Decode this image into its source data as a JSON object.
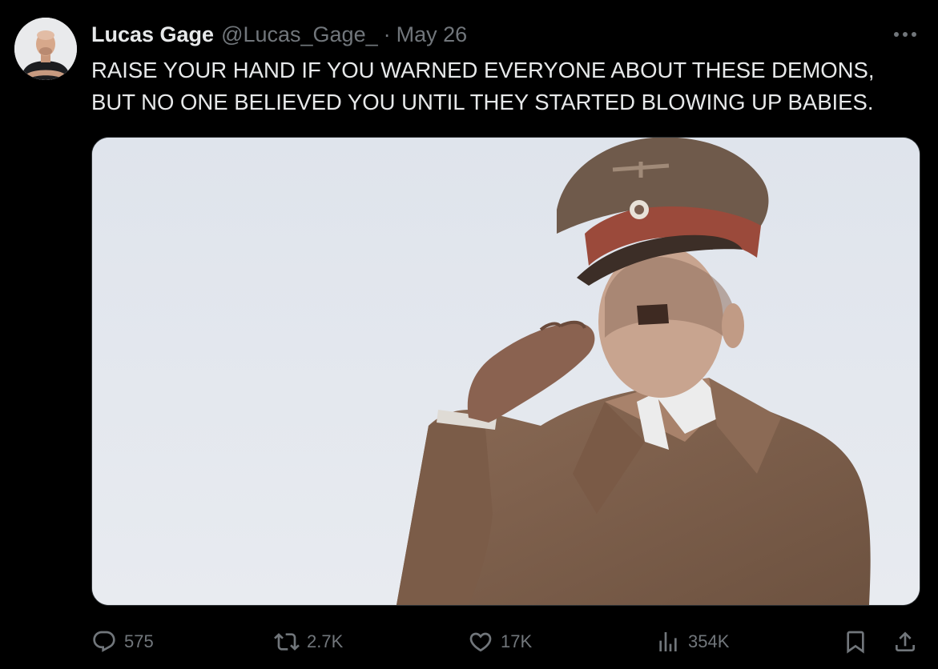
{
  "tweet": {
    "author": {
      "display_name": "Lucas Gage",
      "handle": "@Lucas_Gage_"
    },
    "separator": "·",
    "date": "May 26",
    "text_lines": [
      "RAISE YOUR HAND IF YOU WARNED EVERYONE ABOUT THESE DEMONS,",
      "BUT NO ONE BELIEVED YOU UNTIL THEY STARTED BLOWING UP BABIES."
    ]
  },
  "actions": {
    "reply": {
      "icon": "reply-icon",
      "count": "575"
    },
    "retweet": {
      "icon": "retweet-icon",
      "count": "2.7K"
    },
    "like": {
      "icon": "heart-icon",
      "count": "17K"
    },
    "views": {
      "icon": "analytics-icon",
      "count": "354K"
    },
    "bookmark": {
      "icon": "bookmark-icon"
    },
    "share": {
      "icon": "share-icon"
    }
  },
  "colors": {
    "background": "#000000",
    "primary_text": "#e7e9ea",
    "secondary_text": "#71767b",
    "border": "#2f3336"
  }
}
